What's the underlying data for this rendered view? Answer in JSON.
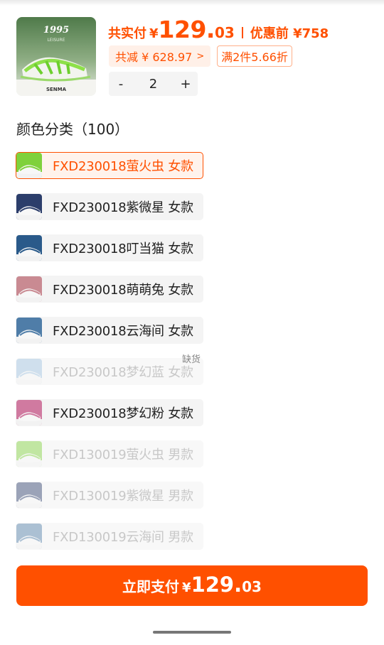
{
  "header": {
    "paid_label": "共实付",
    "currency": "¥",
    "price_int": "129.",
    "price_dec": "03",
    "before_label": "优惠前 ¥758",
    "reduce_chip": "共减 ¥ 628.97",
    "reduce_arrow": ">",
    "deal_chip": "满2件5.66折"
  },
  "product_image": {
    "brand_text": "1995",
    "sub_text": "LEISURE",
    "logo_text": "SENMA"
  },
  "quantity": {
    "minus": "-",
    "value": "2",
    "plus": "+"
  },
  "variants_section": {
    "title": "颜色分类（100）",
    "items": [
      {
        "label": "FXD230018萤火虫 女款",
        "state": "selected",
        "color": "#7fd13c"
      },
      {
        "label": "FXD230018紫微星 女款",
        "state": "normal",
        "color": "#2c3e6b"
      },
      {
        "label": "FXD230018叮当猫 女款",
        "state": "normal",
        "color": "#2a5a8a"
      },
      {
        "label": "FXD230018萌萌兔 女款",
        "state": "normal",
        "color": "#c98a92"
      },
      {
        "label": "FXD230018云海间 女款",
        "state": "normal",
        "color": "#4f7da8"
      },
      {
        "label": "FXD230018梦幻蓝 女款",
        "state": "disabled",
        "color": "#9fc3e0",
        "tag": "缺货"
      },
      {
        "label": "FXD230018梦幻粉 女款",
        "state": "normal",
        "color": "#d07aa0"
      },
      {
        "label": "FXD130019萤火虫 男款",
        "state": "disabled",
        "color": "#7fd13c"
      },
      {
        "label": "FXD130019紫微星 男款",
        "state": "disabled",
        "color": "#2c3e6b"
      },
      {
        "label": "FXD130019云海间 男款",
        "state": "disabled",
        "color": "#4f7da8"
      }
    ]
  },
  "pay_button": {
    "label": "立即支付",
    "currency": "¥",
    "price_int": "129.",
    "price_dec": "03"
  },
  "colors": {
    "accent": "#ff5000"
  }
}
